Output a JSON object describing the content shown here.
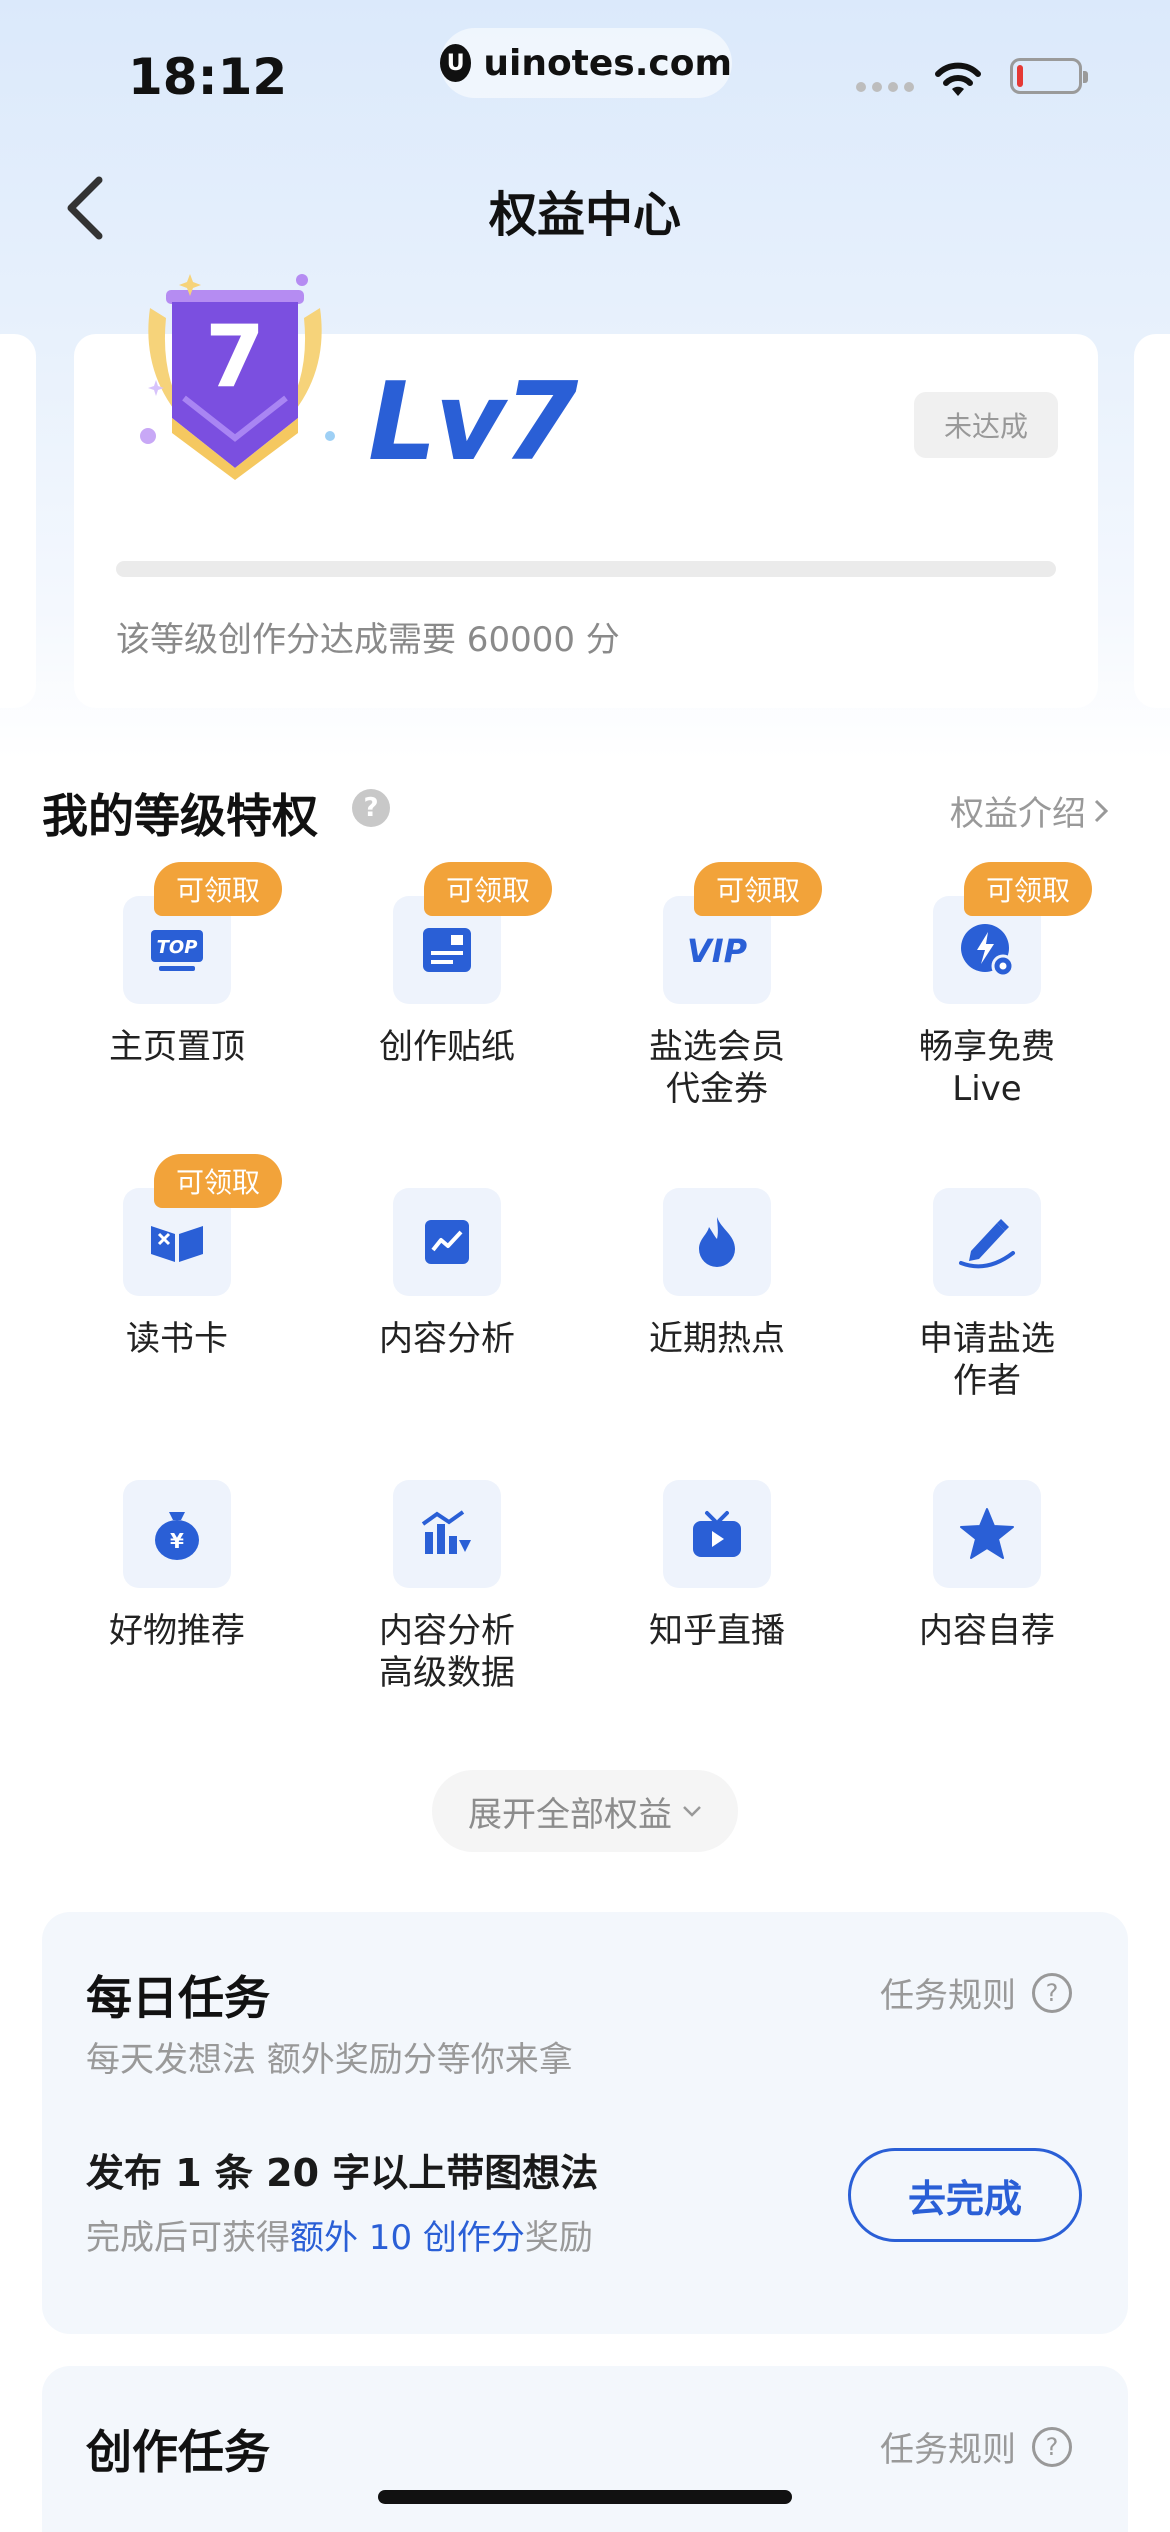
{
  "status_bar": {
    "time": "18:12",
    "url": "uinotes.com",
    "url_logo": "U",
    "battery_level": 0.1
  },
  "nav": {
    "title": "权益中心"
  },
  "level": {
    "badge_number": "7",
    "name": "Lv7",
    "status": "未达成",
    "progress": 0,
    "desc": "该等级创作分达成需要 60000 分"
  },
  "privileges": {
    "title": "我的等级特权",
    "help_glyph": "?",
    "intro_link": "权益介绍",
    "items": [
      {
        "label": "主页置顶",
        "claim": "可领取",
        "icon": "top-pin-icon"
      },
      {
        "label": "创作贴纸",
        "claim": "可领取",
        "icon": "sticker-icon"
      },
      {
        "label": "盐选会员\n代金券",
        "claim": "可领取",
        "icon": "vip-voucher-icon"
      },
      {
        "label": "畅享免费\nLive",
        "claim": "可领取",
        "icon": "free-live-icon"
      },
      {
        "label": "读书卡",
        "claim": "可领取",
        "icon": "book-card-icon"
      },
      {
        "label": "内容分析",
        "claim": "",
        "icon": "analytics-icon"
      },
      {
        "label": "近期热点",
        "claim": "",
        "icon": "flame-icon"
      },
      {
        "label": "申请盐选\n作者",
        "claim": "",
        "icon": "pen-icon"
      },
      {
        "label": "好物推荐",
        "claim": "",
        "icon": "money-bag-icon"
      },
      {
        "label": "内容分析\n高级数据",
        "claim": "",
        "icon": "advanced-chart-icon"
      },
      {
        "label": "知乎直播",
        "claim": "",
        "icon": "tv-icon"
      },
      {
        "label": "内容自荐",
        "claim": "",
        "icon": "star-icon"
      }
    ],
    "expand_label": "展开全部权益"
  },
  "daily_task": {
    "title": "每日任务",
    "rule_label": "任务规则",
    "rule_glyph": "?",
    "subtitle": "每天发想法 额外奖励分等你来拿",
    "item_title": "发布 1 条 20 字以上带图想法",
    "item_desc_prefix": "完成后可获得",
    "item_desc_highlight": "额外 10 创作分",
    "item_desc_suffix": "奖励",
    "button": "去完成"
  },
  "create_task": {
    "title": "创作任务",
    "rule_label": "任务规则",
    "rule_glyph": "?"
  },
  "colors": {
    "accent": "#2a5fd6",
    "claim_badge": "#f2a33a",
    "badge_purple": "#7b4fe0"
  }
}
